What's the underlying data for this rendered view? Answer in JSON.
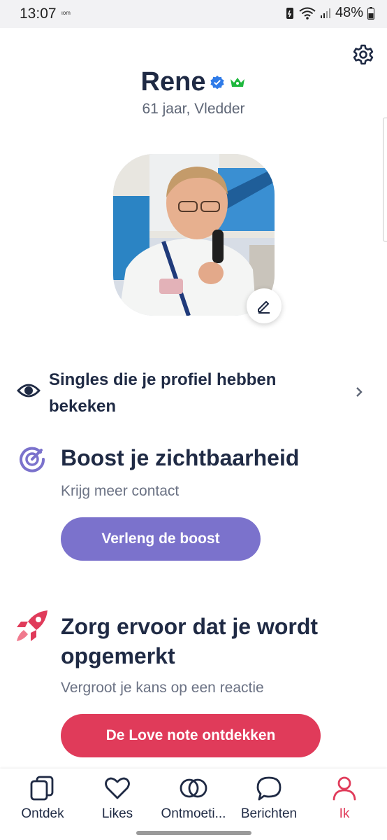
{
  "status_bar": {
    "time": "13:07",
    "small_indicator": "ιom",
    "battery": "48%"
  },
  "profile": {
    "name": "Rene",
    "age_location": "61 jaar, Vledder"
  },
  "viewed": {
    "label": "Singles die je profiel hebben bekeken"
  },
  "boost": {
    "title": "Boost je zichtbaarheid",
    "subtitle": "Krijg meer contact",
    "button": "Verleng de boost",
    "color": "#7b72cc"
  },
  "lovenote": {
    "title": "Zorg ervoor dat je wordt opgemerkt",
    "subtitle": "Vergroot je kans op een reactie",
    "button": "De Love note ontdekken",
    "color": "#e03b5a"
  },
  "nav": [
    {
      "label": "Ontdek",
      "icon": "cards-icon"
    },
    {
      "label": "Likes",
      "icon": "heart-icon"
    },
    {
      "label": "Ontmoeti...",
      "icon": "rings-icon"
    },
    {
      "label": "Berichten",
      "icon": "chat-bubble-icon"
    },
    {
      "label": "Ik",
      "icon": "person-icon",
      "active": true
    }
  ]
}
